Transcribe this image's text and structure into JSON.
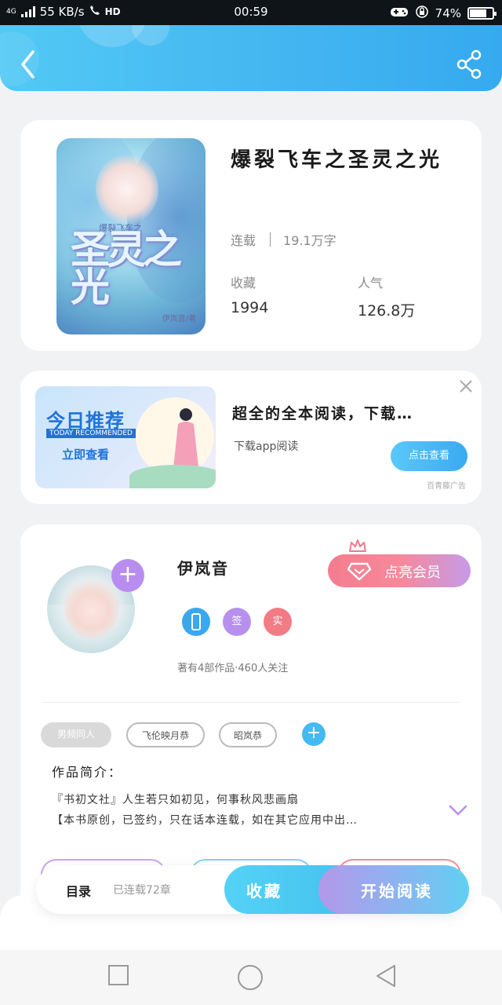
{
  "status_bar": {
    "network": "4G",
    "speed": "55 KB/s",
    "hd": "HD",
    "time": "00:59",
    "battery": "74%",
    "battery_level": 0.74
  },
  "header": {
    "back_icon": "chevron-left-icon",
    "share_icon": "share-icon"
  },
  "book": {
    "title": "爆裂飞车之圣灵之光",
    "cover_title": "圣灵之光",
    "cover_subtitle": "爆裂飞车之",
    "cover_author": "伊岚音/著",
    "status": "连载",
    "word_count": "19.1万字",
    "favorites_label": "收藏",
    "favorites_value": "1994",
    "popularity_label": "人气",
    "popularity_value": "126.8万"
  },
  "ad": {
    "banner_title": "今日推荐",
    "banner_subtitle": "TODAY RECOMMENDED",
    "banner_cta": "立即查看",
    "title": "超全的全本阅读，下载…",
    "description": "下载app阅读",
    "button": "点击查看",
    "source": "百青藤广告"
  },
  "author": {
    "name": "伊岚音",
    "vip_button": "点亮会员",
    "badges": [
      {
        "label": "",
        "color": "#3aa7ef"
      },
      {
        "label": "签",
        "color": "#b790ee"
      },
      {
        "label": "实",
        "color": "#f27b86"
      }
    ],
    "stats": "著有4部作品·460人关注",
    "tags": [
      "男频同人",
      "飞伦映月恭",
      "昭岚恭"
    ],
    "intro_title": "作品简介：",
    "intro_lines": [
      "『书初文社』人生若只如初见，何事秋风悲画扇",
      "【本书原创，已签约，只在话本连载，如在其它应用中出…"
    ]
  },
  "action_bar": {
    "toc_label": "目录",
    "toc_status": "已连载72章",
    "collect": "收藏",
    "read": "开始阅读"
  },
  "colors": {
    "header_blue": "#45b8f1",
    "accent_pink": "#f47d8f",
    "accent_purple": "#b98df0",
    "accent_cyan": "#45b9f2"
  }
}
